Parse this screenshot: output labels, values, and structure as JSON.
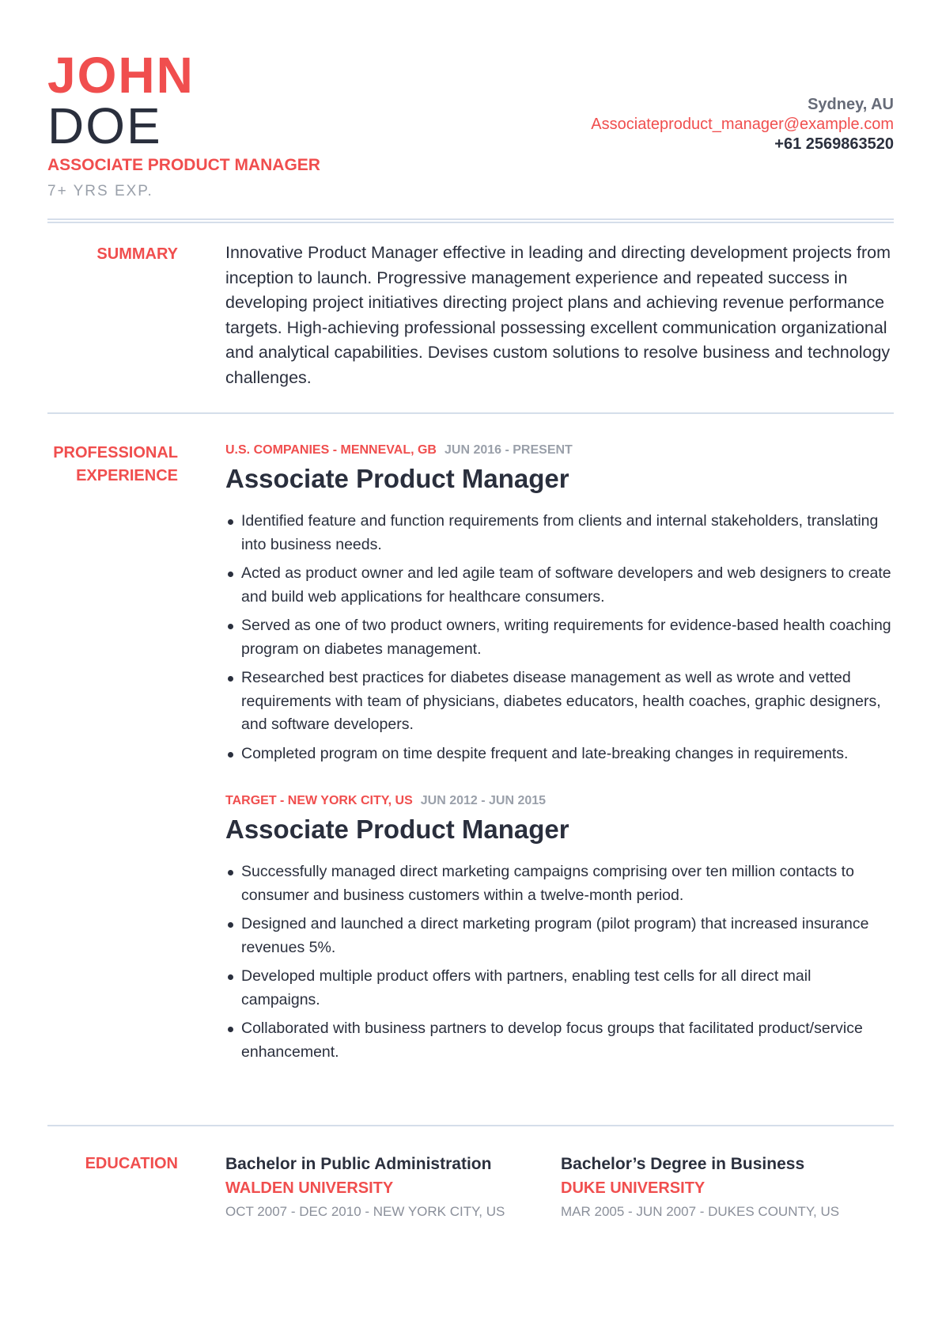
{
  "header": {
    "first_name": "JOHN",
    "last_name": "DOE",
    "title": "ASSOCIATE PRODUCT MANAGER",
    "experience": "7+ YRS EXP.",
    "location": "Sydney, AU",
    "email": "Associateproduct_manager@example.com",
    "phone": "+61 2569863520"
  },
  "summary": {
    "label": "SUMMARY",
    "text": "Innovative Product Manager effective in leading and directing development projects from inception to launch. Progressive management experience and repeated success in developing project initiatives directing project plans and achieving revenue performance targets. High-achieving professional possessing excellent communication organizational and analytical capabilities. Devises custom solutions to resolve business and technology challenges."
  },
  "experience": {
    "label_line1": "PROFESSIONAL",
    "label_line2": "EXPERIENCE",
    "jobs": [
      {
        "company": "U.S. COMPANIES - MENNEVAL, GB",
        "dates": "JUN 2016 - PRESENT",
        "role": "Associate Product Manager",
        "bullets": [
          "Identified feature and function requirements from clients and internal stakeholders, translating into business needs.",
          "Acted as product owner and led agile team of software developers and web designers to create and build web applications for healthcare consumers.",
          "Served as one of two product owners, writing requirements for evidence-based health coaching program on diabetes management.",
          "Researched best practices for diabetes disease management as well as wrote and vetted requirements with team of physicians, diabetes educators, health coaches, graphic designers, and software developers.",
          "Completed program on time despite frequent and late-breaking changes in requirements."
        ]
      },
      {
        "company": "TARGET - NEW YORK CITY, US",
        "dates": "JUN 2012 - JUN 2015",
        "role": "Associate Product Manager",
        "bullets": [
          "Successfully managed direct marketing campaigns comprising over ten million contacts to consumer and business customers within a twelve-month period.",
          "Designed and launched a direct marketing program (pilot program) that increased insurance revenues 5%.",
          "Developed multiple product offers with partners, enabling test cells for all direct mail campaigns.",
          "Collaborated with business partners to develop focus groups that facilitated product/service enhancement."
        ]
      }
    ]
  },
  "education": {
    "label": "EDUCATION",
    "items": [
      {
        "degree": "Bachelor in Public Administration",
        "school": "WALDEN UNIVERSITY",
        "details": "OCT 2007 - DEC 2010 - NEW YORK CITY, US"
      },
      {
        "degree": "Bachelor’s Degree in Business",
        "school": "DUKE UNIVERSITY",
        "details": "MAR 2005 - JUN 2007 - DUKES COUNTY, US"
      }
    ]
  }
}
